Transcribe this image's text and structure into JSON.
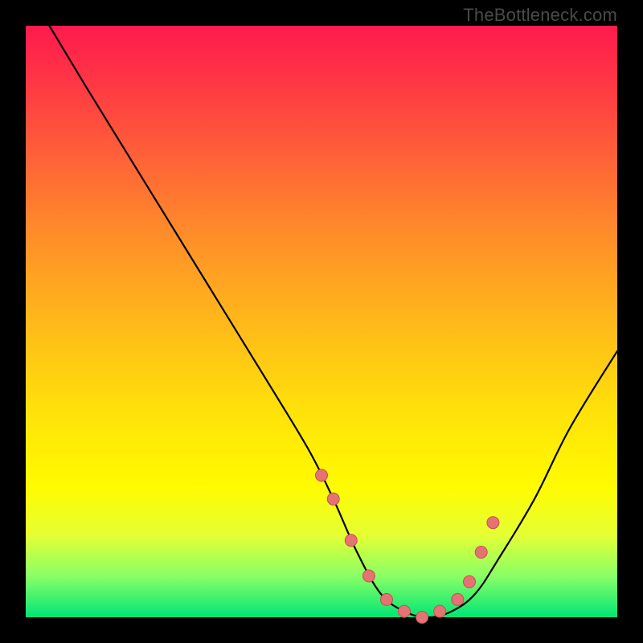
{
  "attribution": "TheBottleneck.com",
  "colors": {
    "background": "#000000",
    "gradient_top": "#ff1a4d",
    "gradient_mid": "#fffb00",
    "gradient_bottom": "#00e676",
    "curve": "#000000",
    "marker_fill": "#e57373",
    "marker_stroke": "#c94f4f"
  },
  "chart_data": {
    "type": "line",
    "title": "",
    "xlabel": "",
    "ylabel": "",
    "xlim": [
      0,
      100
    ],
    "ylim": [
      0,
      100
    ],
    "grid": false,
    "legend": false,
    "note": "V-shaped bottleneck curve. Y reads as percentage bottleneck (top=100, bottom=0). Minimum (≈0%) sits roughly between x≈58 and x≈74. Left arm is steep and starts near top-left; right arm rises more gently and exits near x=100 at y≈45.",
    "series": [
      {
        "name": "bottleneck-curve",
        "x": [
          4,
          10,
          18,
          26,
          34,
          42,
          48,
          52,
          56,
          60,
          64,
          68,
          72,
          76,
          80,
          86,
          92,
          100
        ],
        "y": [
          100,
          90,
          77,
          64,
          51,
          38,
          28,
          20,
          11,
          4,
          1,
          0,
          1,
          4,
          10,
          20,
          32,
          45
        ]
      }
    ],
    "markers": {
      "name": "highlight-dots",
      "note": "Salmon dots clustered around the trough on both arms",
      "x": [
        50,
        52,
        55,
        58,
        61,
        64,
        67,
        70,
        73,
        75,
        77,
        79
      ],
      "y": [
        24,
        20,
        13,
        7,
        3,
        1,
        0,
        1,
        3,
        6,
        11,
        16
      ]
    }
  }
}
